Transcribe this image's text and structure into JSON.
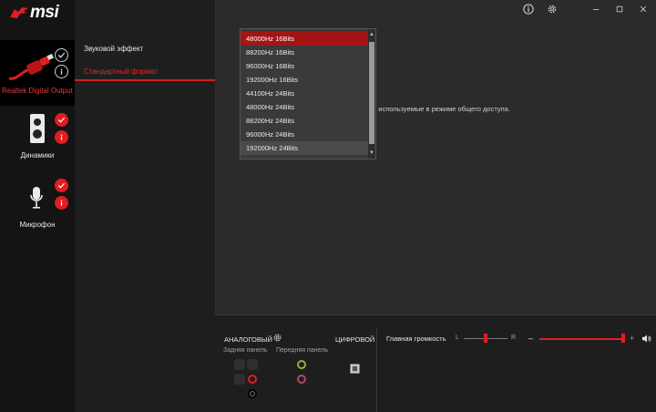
{
  "app": {
    "brand": "msi",
    "accent": "#e11d22"
  },
  "devices": [
    {
      "label": "Realtek Digital Output",
      "icon": "digital-cable-icon",
      "active": true
    },
    {
      "label": "Динамики",
      "icon": "speaker-icon",
      "active": false
    },
    {
      "label": "Микрофон",
      "icon": "microphone-icon",
      "active": false
    }
  ],
  "tabs": {
    "effect": "Звуковой эффект",
    "format": "Стандартный формат"
  },
  "main": {
    "hint": "сть, используемые в режиме общего доступа."
  },
  "format_options": [
    "48000Hz 16Bits",
    "88200Hz 16Bits",
    "96000Hz 16Bits",
    "192000Hz 16Bits",
    "44100Hz 24Bits",
    "48000Hz 24Bits",
    "88200Hz 24Bits",
    "96000Hz 24Bits",
    "192000Hz 24Bits"
  ],
  "bottom": {
    "analog": "АНАЛОГОВЫЙ",
    "digital": "ЦИФРОВОЙ",
    "rear_panel": "Задняя панель",
    "front_panel": "Передняя панель",
    "master_volume": "Главная громкость",
    "left": "L",
    "right": "R",
    "minus": "–",
    "plus": "+",
    "balance_level": 0.5,
    "volume_level": 1.0
  }
}
